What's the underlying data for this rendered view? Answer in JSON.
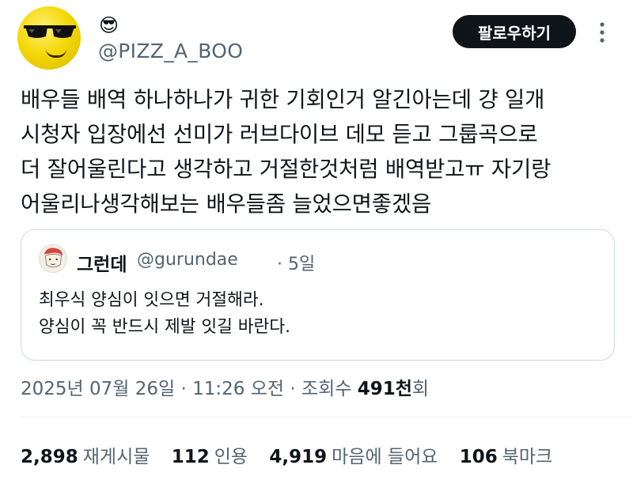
{
  "author": {
    "display_emoji": "😎",
    "handle": "@PIZZ_A_BOO"
  },
  "follow_label": "팔로우하기",
  "tweet_lines": [
    "배우들 배역 하나하나가 귀한 기회인거 알긴아는데 걍 일개",
    "시청자 입장에선 선미가 러브다이브 데모 듣고 그룹곡으로",
    "더 잘어울린다고 생각하고 거절한것처럼 배역받고ㅠ 자기랑",
    "어울리나생각해보는 배우들좀 늘었으면좋겠음"
  ],
  "quote": {
    "name": "그런데",
    "handle": "@gurundae",
    "time": "· 5일",
    "lines": [
      "최우식 양심이 잇으면 거절해라.",
      "양심이 꼭 반드시 제발 잇길 바란다."
    ]
  },
  "meta": {
    "date_time": "2025년 07월 26일 · 11:26 오전 · 조회수 ",
    "views": "491천",
    "views_suffix": "회"
  },
  "stats": {
    "retweets": {
      "count": "2,898",
      "label": "재게시물"
    },
    "quotes": {
      "count": "112",
      "label": "인용"
    },
    "likes": {
      "count": "4,919",
      "label": "마음에 들어요"
    },
    "bookmarks": {
      "count": "106",
      "label": "북마크"
    }
  },
  "colors": {
    "text": "#0f1419",
    "secondary": "#536471",
    "border": "#cfd9de",
    "button": "#0f1419"
  },
  "icons": [
    "more-icon"
  ]
}
